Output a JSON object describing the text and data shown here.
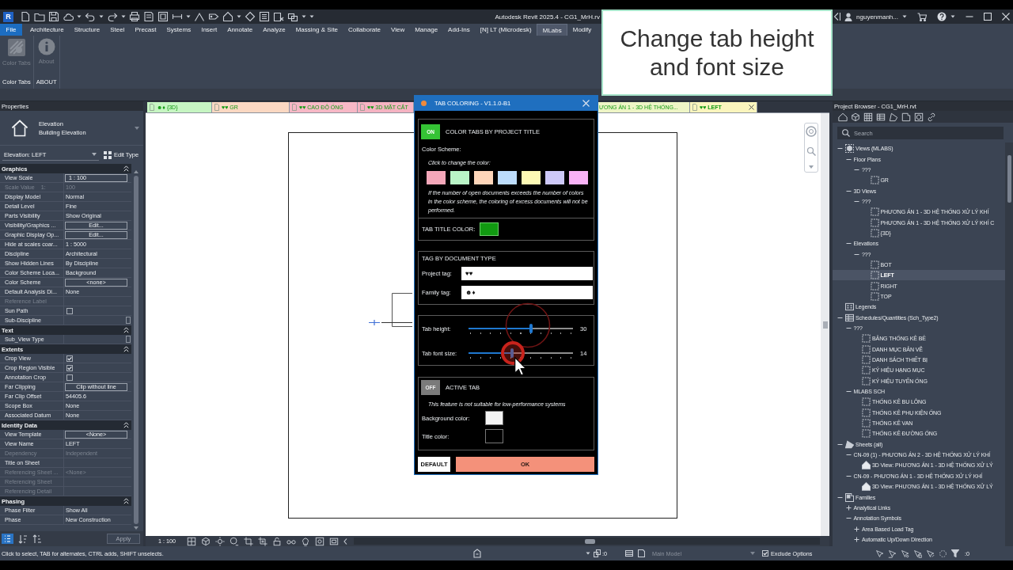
{
  "title_bar": {
    "logo": "R",
    "title": "Autodesk Revit 2025.4 - CG1_MrH.rv",
    "user": "nguyenmanh..."
  },
  "ribbon": {
    "tabs": [
      {
        "label": "File",
        "kind": "file",
        "selected": false
      },
      {
        "label": "Architecture",
        "kind": "tab",
        "selected": false
      },
      {
        "label": "Structure",
        "kind": "tab",
        "selected": false
      },
      {
        "label": "Steel",
        "kind": "tab",
        "selected": false
      },
      {
        "label": "Precast",
        "kind": "tab",
        "selected": false
      },
      {
        "label": "Systems",
        "kind": "tab",
        "selected": false
      },
      {
        "label": "Insert",
        "kind": "tab",
        "selected": false
      },
      {
        "label": "Annotate",
        "kind": "tab",
        "selected": false
      },
      {
        "label": "Analyze",
        "kind": "tab",
        "selected": false
      },
      {
        "label": "Massing & Site",
        "kind": "tab",
        "selected": false
      },
      {
        "label": "Collaborate",
        "kind": "tab",
        "selected": false
      },
      {
        "label": "View",
        "kind": "tab",
        "selected": false
      },
      {
        "label": "Manage",
        "kind": "tab",
        "selected": false
      },
      {
        "label": "Add-Ins",
        "kind": "tab",
        "selected": false
      },
      {
        "label": "[N] LT (Microdesk)",
        "kind": "tab",
        "selected": false
      },
      {
        "label": "MLabs",
        "kind": "tab",
        "selected": true
      },
      {
        "label": "Modify",
        "kind": "tab",
        "selected": false
      }
    ],
    "panels": [
      {
        "title": "Color Tabs",
        "button": {
          "label": "Color Tabs",
          "kind": "palette",
          "disabled": true
        }
      },
      {
        "title": "ABOUT",
        "button": {
          "label": "About",
          "kind": "info",
          "disabled": true
        }
      }
    ]
  },
  "caption": {
    "text": "Change tab height and font size"
  },
  "properties": {
    "title": "Properties",
    "type_family": "Elevation",
    "type_name": "Building Elevation",
    "instance": "Elevation: LEFT",
    "edit_type": "Edit Type",
    "groups": [
      {
        "title": "Graphics",
        "rows": [
          {
            "label": "View Scale",
            "value": "1 : 100",
            "kind": "field",
            "disabled": false
          },
          {
            "label": "Scale Value    1:",
            "value": "100",
            "kind": "text",
            "disabled": true
          },
          {
            "label": "Display Model",
            "value": "Normal",
            "kind": "text",
            "disabled": false
          },
          {
            "label": "Detail Level",
            "value": "Fine",
            "kind": "text",
            "disabled": false
          },
          {
            "label": "Parts Visibility",
            "value": "Show Original",
            "kind": "text",
            "disabled": false
          },
          {
            "label": "Visibility/Graphics ...",
            "value": "Edit...",
            "kind": "button",
            "disabled": false
          },
          {
            "label": "Graphic Display Op...",
            "value": "Edit...",
            "kind": "button",
            "disabled": false
          },
          {
            "label": "Hide at scales coar...",
            "value": "1 : 5000",
            "kind": "text",
            "disabled": false
          },
          {
            "label": "Discipline",
            "value": "Architectural",
            "kind": "text",
            "disabled": false
          },
          {
            "label": "Show Hidden Lines",
            "value": "By Discipline",
            "kind": "text",
            "disabled": false
          },
          {
            "label": "Color Scheme Loca...",
            "value": "Background",
            "kind": "text",
            "disabled": false
          },
          {
            "label": "Color Scheme",
            "value": "<none>",
            "kind": "button",
            "disabled": false
          },
          {
            "label": "Default Analysis Di...",
            "value": "None",
            "kind": "text",
            "disabled": false
          },
          {
            "label": "Reference Label",
            "kind": "text",
            "disabled": true
          },
          {
            "label": "Sun Path",
            "kind": "check",
            "checked": false,
            "disabled": false
          },
          {
            "label": "Sub-Discipline",
            "kind": "picker",
            "disabled": false
          }
        ]
      },
      {
        "title": "Text",
        "rows": [
          {
            "label": "Sub_View Type",
            "kind": "picker",
            "disabled": false
          }
        ]
      },
      {
        "title": "Extents",
        "rows": [
          {
            "label": "Crop View",
            "kind": "check",
            "checked": true,
            "disabled": false
          },
          {
            "label": "Crop Region Visible",
            "kind": "check",
            "checked": true,
            "disabled": false
          },
          {
            "label": "Annotation Crop",
            "kind": "check",
            "checked": false,
            "disabled": false
          },
          {
            "label": "Far Clipping",
            "value": "Clip without line",
            "kind": "button",
            "disabled": false
          },
          {
            "label": "Far Clip Offset",
            "value": "54405.6",
            "kind": "text",
            "disabled": false
          },
          {
            "label": "Scope Box",
            "value": "None",
            "kind": "text",
            "disabled": false
          },
          {
            "label": "Associated Datum",
            "value": "None",
            "kind": "text",
            "disabled": false
          }
        ]
      },
      {
        "title": "Identity Data",
        "rows": [
          {
            "label": "View Template",
            "value": "<None>",
            "kind": "button",
            "disabled": false
          },
          {
            "label": "View Name",
            "value": "LEFT",
            "kind": "text",
            "disabled": false
          },
          {
            "label": "Dependency",
            "value": "Independent",
            "kind": "text",
            "disabled": true
          },
          {
            "label": "Title on Sheet",
            "kind": "text",
            "disabled": false
          },
          {
            "label": "Referencing Sheet ...",
            "value": "<None>",
            "kind": "text",
            "disabled": true
          },
          {
            "label": "Referencing Sheet",
            "kind": "text",
            "disabled": true
          },
          {
            "label": "Referencing Detail",
            "kind": "text",
            "disabled": true
          }
        ]
      },
      {
        "title": "Phasing",
        "rows": [
          {
            "label": "Phase Filter",
            "value": "Show All",
            "kind": "text",
            "disabled": false
          },
          {
            "label": "Phase",
            "value": "New Construction",
            "kind": "text",
            "disabled": false
          }
        ]
      }
    ],
    "apply": {
      "label": "Apply",
      "disabled": true
    }
  },
  "view_tabs": [
    {
      "label": "☻♦ {3D}",
      "color": "#c6f5c2",
      "kind": "full",
      "selected": false
    },
    {
      "label": "♥♥ GR",
      "color": "#fbd8c2",
      "kind": "full",
      "selected": false
    },
    {
      "label": "♥♥ CAO ĐỘ ỐNG",
      "color": "#f7b8c6",
      "kind": "full",
      "selected": false
    },
    {
      "label": "♥♥ 3D MẶT CẮT",
      "color": "#f5b3c2",
      "kind": "full",
      "selected": false
    },
    {
      "label": "ƯƠNG ÁN 1 - 3D HỆ THỐNG...",
      "color": "#eef5c6",
      "kind": "clipped",
      "selected": false
    },
    {
      "label": "♥♥ LEFT",
      "color": "#fbf5bd",
      "kind": "full",
      "selected": true
    }
  ],
  "view_controls": {
    "scale": "1 : 100"
  },
  "dialog": {
    "title": "TAB COLORING - V1.1.0-B1",
    "color_section": {
      "toggle": {
        "label": "ON",
        "on": true
      },
      "title": "COLOR TABS BY PROJECT TITLE",
      "scheme_label": "Color Scheme:",
      "hint": "Click to change the color:",
      "swatches": [
        {
          "color": "#f4a7b9"
        },
        {
          "color": "#b9f4c6"
        },
        {
          "color": "#fdd5b9"
        },
        {
          "color": "#bcdcfb"
        },
        {
          "color": "#fdf9b5"
        },
        {
          "color": "#cdc8f7"
        },
        {
          "color": "#f8b2f6"
        }
      ],
      "note": "If the number of open documents exceeds the number of colors in the color scheme, the coloring of excess documents will not be performed.",
      "tab_title": {
        "label": "TAB TITLE COLOR:",
        "color": "#119a11"
      }
    },
    "tag_section": {
      "title": "TAG BY DOCUMENT TYPE",
      "fields": [
        {
          "label": "Project tag:",
          "value": "♥♥"
        },
        {
          "label": "Family tag:",
          "value": "☻♦"
        }
      ]
    },
    "sliders": [
      {
        "label": "Tab height:",
        "level": 0.6,
        "reading": "30"
      },
      {
        "label": "Tab font size:",
        "level": 0.42,
        "reading": "14"
      }
    ],
    "active_section": {
      "toggle": {
        "label": "OFF",
        "on": false
      },
      "title": "ACTIVE TAB",
      "note": "This feature is not suitable for low-performance systems",
      "colors": [
        {
          "label": "Background color:",
          "color": "#f4f4f4"
        },
        {
          "label": "Title color:",
          "color": "#000000"
        }
      ]
    },
    "buttons": [
      {
        "label": "DEFAULT",
        "kind": "secondary"
      },
      {
        "label": "OK",
        "kind": "primary"
      }
    ]
  },
  "project_browser": {
    "title": "Project Browser - CG1_MrH.rvt",
    "search": {
      "placeholder": "Search"
    },
    "tree": [
      {
        "label": "Views (MLABS)",
        "kind": "views",
        "expanded": true,
        "selected": false,
        "children": [
          {
            "label": "Floor Plans",
            "kind": "group",
            "expanded": true,
            "selected": false,
            "children": [
              {
                "label": "???",
                "kind": "group",
                "expanded": true,
                "selected": false,
                "children": [
                  {
                    "label": "GR",
                    "kind": "view",
                    "selected": false
                  }
                ]
              }
            ]
          },
          {
            "label": "3D Views",
            "kind": "group",
            "expanded": true,
            "selected": false,
            "children": [
              {
                "label": "???",
                "kind": "group",
                "expanded": true,
                "selected": false,
                "children": [
                  {
                    "label": "PHƯƠNG ÁN 1 - 3D HỆ THỐNG XỬ LÝ KHÍ",
                    "kind": "view",
                    "selected": false
                  },
                  {
                    "label": "PHƯƠNG ÁN 1 - 3D HỆ THỐNG XỬ LÝ KHÍ C",
                    "kind": "view",
                    "selected": false
                  },
                  {
                    "label": "{3D}",
                    "kind": "view",
                    "selected": false
                  }
                ]
              }
            ]
          },
          {
            "label": "Elevations",
            "kind": "group",
            "expanded": true,
            "selected": false,
            "children": [
              {
                "label": "???",
                "kind": "group",
                "expanded": true,
                "selected": false,
                "children": [
                  {
                    "label": "BOT",
                    "kind": "view",
                    "selected": false
                  },
                  {
                    "label": "LEFT",
                    "kind": "view",
                    "selected": true
                  },
                  {
                    "label": "RIGHT",
                    "kind": "view",
                    "selected": false
                  },
                  {
                    "label": "TOP",
                    "kind": "view",
                    "selected": false
                  }
                ]
              }
            ]
          }
        ]
      },
      {
        "label": "Legends",
        "kind": "legends",
        "selected": false
      },
      {
        "label": "Schedules/Quantities (Sch_Type2)",
        "kind": "schedules",
        "expanded": true,
        "selected": false,
        "children": [
          {
            "label": "???",
            "kind": "group",
            "expanded": true,
            "selected": false,
            "children": [
              {
                "label": "BẢNG THỐNG KÊ BỂ",
                "kind": "view",
                "selected": false
              },
              {
                "label": "DANH MỤC BẢN VẼ",
                "kind": "view",
                "selected": false
              },
              {
                "label": "DANH SÁCH THIẾT BỊ",
                "kind": "view",
                "selected": false
              },
              {
                "label": "KÝ HIỆU HẠNG MỤC",
                "kind": "view",
                "selected": false
              },
              {
                "label": "KÝ HIỆU TUYẾN ỐNG",
                "kind": "view",
                "selected": false
              }
            ]
          },
          {
            "label": "MLABS SCH",
            "kind": "group",
            "expanded": true,
            "selected": false,
            "children": [
              {
                "label": "THỐNG KÊ BU LÔNG",
                "kind": "view",
                "selected": false
              },
              {
                "label": "THỐNG KÊ PHỤ KIỆN ỐNG",
                "kind": "view",
                "selected": false
              },
              {
                "label": "THỐNG KÊ VAN",
                "kind": "view",
                "selected": false
              },
              {
                "label": "THỐNG KÊ ĐƯỜNG ỐNG",
                "kind": "view",
                "selected": false
              }
            ]
          }
        ]
      },
      {
        "label": "Sheets (all)",
        "kind": "sheets",
        "expanded": true,
        "selected": false,
        "children": [
          {
            "label": "CN-09 (1) - PHƯƠNG ÁN 2 - 3D HỆ THỐNG XỬ LÝ KHÍ",
            "kind": "group",
            "expanded": true,
            "selected": false,
            "children": [
              {
                "label": "3D View: PHƯƠNG ÁN 1 - 3D HỆ THỐNG XỬ LÝ",
                "kind": "sheetview",
                "selected": false
              }
            ]
          },
          {
            "label": "CN-09 - PHƯƠNG ÁN 1 - 3D HỆ THỐNG XỬ LÝ KHÍ",
            "kind": "group",
            "expanded": true,
            "selected": false,
            "children": [
              {
                "label": "3D View: PHƯƠNG ÁN 1 - 3D HỆ THỐNG XỬ LÝ",
                "kind": "sheetview",
                "selected": false
              }
            ]
          }
        ]
      },
      {
        "label": "Families",
        "kind": "families",
        "expanded": true,
        "selected": false,
        "children": [
          {
            "label": "Analytical Links",
            "kind": "group",
            "expanded": false,
            "selected": false
          },
          {
            "label": "Annotation Symbols",
            "kind": "group",
            "expanded": true,
            "selected": false,
            "children": [
              {
                "label": "Area Based Load Tag",
                "kind": "group",
                "expanded": false,
                "selected": false
              },
              {
                "label": "Automatic Up/Down Direction",
                "kind": "group",
                "expanded": false,
                "selected": false
              }
            ]
          }
        ]
      }
    ]
  },
  "status_bar": {
    "message": "Click to select, TAB for alternates, CTRL adds, SHIFT unselects.",
    "left_counter": ":0",
    "design_option": {
      "value": "Main Model",
      "disabled": true
    },
    "exclude_options": {
      "label": "Exclude Options",
      "checked": true
    },
    "filter_counter": ":0"
  }
}
